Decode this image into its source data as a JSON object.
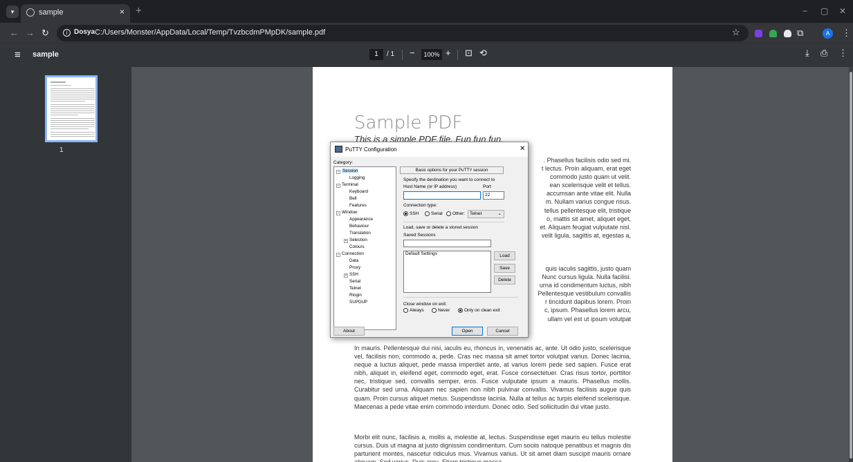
{
  "browser": {
    "tab_title": "sample",
    "tab_close": "×",
    "new_tab": "+",
    "window_controls": [
      "−",
      "▢",
      "✕"
    ],
    "security_chip": "Dosya",
    "url": "C:/Users/Monster/AppData/Local/Temp/TvzbcdmPMpDK/sample.pdf",
    "avatar_letter": "A"
  },
  "pdf_toolbar": {
    "doc_name": "sample",
    "page_current": "1",
    "page_total": "/ 1",
    "zoom_out": "−",
    "zoom": "100%",
    "zoom_in": "+"
  },
  "sidebar": {
    "thumb_label": "1"
  },
  "pdf": {
    "title": "Sample PDF",
    "subtitle": "This is a simple PDF file. Fun fun fun.",
    "para1_lines": [
      ". Phasellus facilisis odio sed mi.",
      "t lectus. Proin aliquam, erat eget",
      "commodo justo quam ut velit.",
      "ean scelerisque velit et tellus.",
      "accumsan ante vitae elit. Nulla",
      "m. Nullam varius congue risus.",
      "tellus pellentesque elit, tristique",
      "o, mattis sit amet, aliquet eget,",
      "et. Aliquam feugiat vulputate nisl.",
      "velit ligula, sagittis at, egestas a,"
    ],
    "para2_lines": [
      "quis iaculis sagittis, justo quam",
      "Nunc cursus ligula. Nulla facilisi.",
      "urna id condimentum luctus, nibh",
      "Pellentesque vestibulum convallis",
      "r tincidunt dapibus lorem. Proin",
      "c, ipsum. Phasellus lorem arcu,",
      "ullam vel est ut ipsum volutpat"
    ],
    "para3": "In mauris. Pellentesque dui nisi, iaculis eu, rhoncus in, venenatis ac, ante. Ut odio justo, scelerisque vel, facilisis non, commodo a, pede. Cras nec massa sit amet tortor volutpat varius. Donec lacinia, neque a luctus aliquet, pede massa imperdiet ante, at varius lorem pede sed sapien. Fusce erat nibh, aliquet in, eleifend eget, commodo eget, erat. Fusce consectetuer. Cras risus tortor, porttitor nec, tristique sed, convallis semper, eros. Fusce vulputate ipsum a mauris. Phasellus mollis. Curabitur sed urna. Aliquam nec sapien non nibh pulvinar convallis. Vivamus facilisis augue quis quam. Proin cursus aliquet metus. Suspendisse lacinia. Nulla at tellus ac turpis eleifend scelerisque. Maecenas a pede vitae enim commodo interdum. Donec odio. Sed sollicitudin dui vitae justo.",
    "para4": "Morbi elit nunc, facilisis a, mollis a, molestie at, lectus. Suspendisse eget mauris eu tellus molestie cursus. Duis ut magna at justo dignissim condimentum. Cum sociis natoque penatibus et magnis dis parturient montes, nascetur ridiculus mus. Vivamus varius. Ut sit amet diam suscipit mauris ornare aliquam. Sed varius. Duis arcu. Etiam tristique massa"
  },
  "putty": {
    "title": "PuTTY Configuration",
    "close": "✕",
    "category_label": "Category:",
    "tree": [
      "Session",
      "Logging",
      "Terminal",
      "Keyboard",
      "Bell",
      "Features",
      "Window",
      "Appearance",
      "Behaviour",
      "Translation",
      "Selection",
      "Colours",
      "Connection",
      "Data",
      "Proxy",
      "SSH",
      "Serial",
      "Telnet",
      "Rlogin",
      "SUPDUP"
    ],
    "panel_header": "Basic options for your PuTTY session",
    "specify_label": "Specify the destination you want to connect to",
    "host_label": "Host Name (or IP address)",
    "host_value": "",
    "port_label": "Port",
    "port_value": "22",
    "conn_type_label": "Connection type:",
    "conn_types": [
      "SSH",
      "Serial",
      "Other:"
    ],
    "other_select": "Telnet",
    "load_save_label": "Load, save or delete a stored session",
    "saved_sessions_label": "Saved Sessions",
    "saved_sessions_value": "",
    "sessions": [
      "Default Settings"
    ],
    "btn_load": "Load",
    "btn_save": "Save",
    "btn_delete": "Delete",
    "close_window_label": "Close window on exit:",
    "close_options": [
      "Always",
      "Never",
      "Only on clean exit"
    ],
    "btn_about": "About",
    "btn_open": "Open",
    "btn_cancel": "Cancel"
  }
}
